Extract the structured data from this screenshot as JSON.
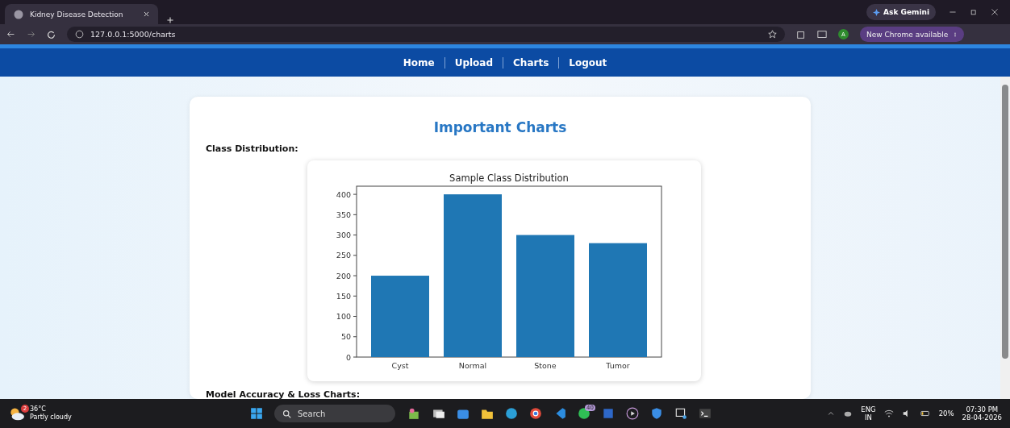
{
  "browser": {
    "tab_title": "Kidney Disease Detection",
    "address": "127.0.0.1:5000/charts",
    "gemini_label": "Ask Gemini",
    "profile_initial": "A",
    "update_label": "New Chrome available"
  },
  "nav": {
    "items": [
      {
        "label": "Home"
      },
      {
        "label": "Upload"
      },
      {
        "label": "Charts"
      },
      {
        "label": "Logout"
      }
    ]
  },
  "page": {
    "title": "Important Charts",
    "sections": [
      {
        "heading": "Class Distribution:",
        "chart_data": {
          "type": "bar",
          "title": "Sample Class Distribution",
          "categories": [
            "Cyst",
            "Normal",
            "Stone",
            "Tumor"
          ],
          "values": [
            200,
            400,
            300,
            280
          ],
          "ylim": [
            0,
            420
          ],
          "yticks": [
            0,
            50,
            100,
            150,
            200,
            250,
            300,
            350,
            400
          ]
        }
      },
      {
        "heading": "Model Accuracy & Loss Charts:"
      }
    ]
  },
  "taskbar": {
    "weather": {
      "temp": "36°C",
      "condition": "Partly cloudy",
      "badge": "2"
    },
    "search_placeholder": "Search",
    "whatsapp_badge": "40",
    "language": "ENG",
    "region": "IN",
    "battery": "20%",
    "time": "07:30 PM",
    "date": "28-04-2026"
  }
}
